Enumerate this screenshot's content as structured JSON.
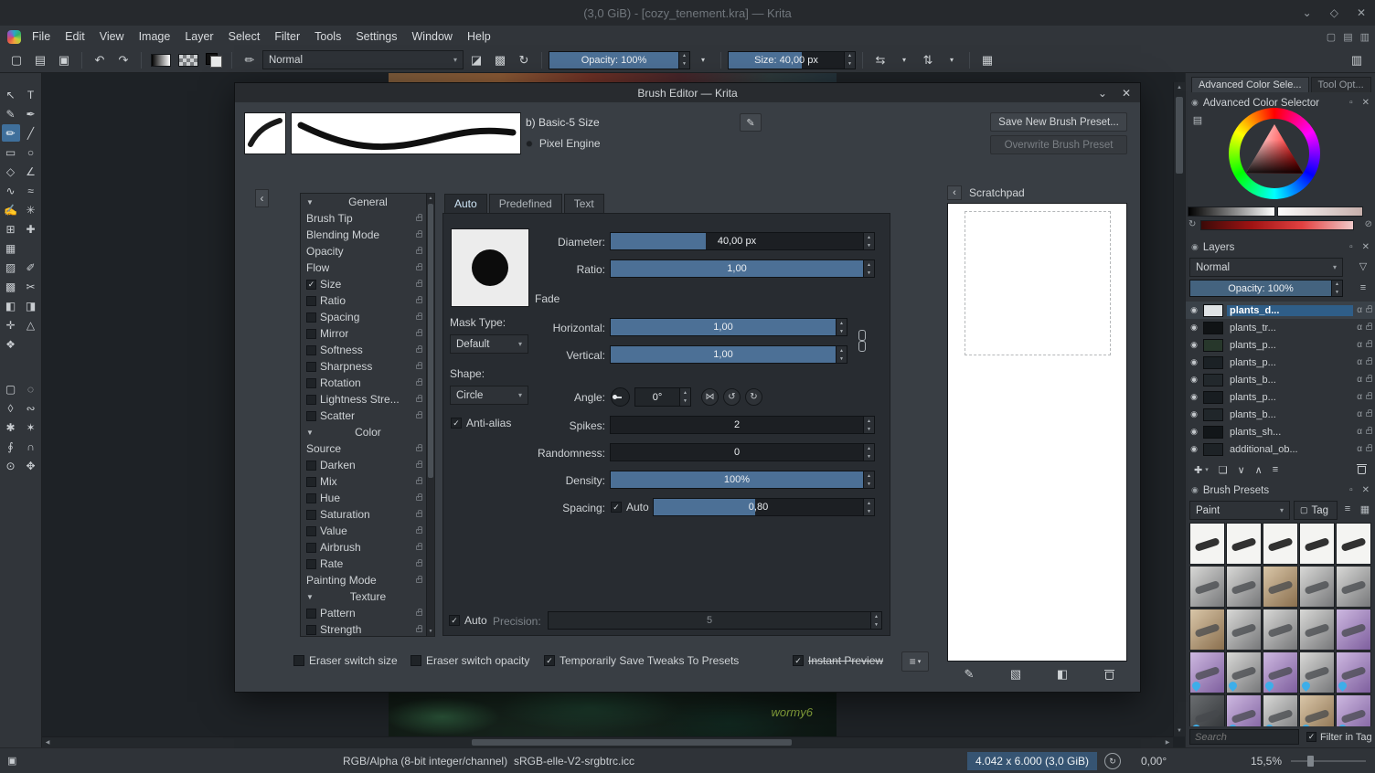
{
  "icons": {
    "chevron_down": "⌄",
    "diamond": "◇",
    "close": "✕",
    "new_document": "▢",
    "open_document": "▤",
    "save_document": "▣",
    "undo": "↶",
    "redo": "↷",
    "brush_settings": "✏",
    "eraser": "◪",
    "preserve_alpha": "▩",
    "reload": "↻",
    "dropdown": "▾",
    "mirror_horizontal": "⇆",
    "mirror_vertical": "⇅",
    "wrap_around": "▦",
    "workspace_chooser": "▥",
    "dockers_a": "▢",
    "dockers_b": "▤",
    "dockers_c": "▥",
    "collapse_left": "‹",
    "section_arrow": "▼",
    "edit_pencil": "✎",
    "engine_dot": "●",
    "scroll_up": "▲",
    "scroll_down": "▼",
    "scroll_left": "◀",
    "scroll_right": "▶",
    "angle_flip": "⋈",
    "rotate_ccw": "↺",
    "rotate_cw": "↻",
    "hamburger": "≡",
    "eye": "◉",
    "alpha": "α",
    "docker_dot": "◉",
    "float_panel": "▫",
    "settings_list": "▤",
    "refresh": "↻",
    "clear": "⊘",
    "funnel": "▽",
    "add": "✚",
    "duplicate": "❏",
    "arrow_down": "∨",
    "arrow_up": "∧",
    "tag": "▢",
    "grid_view": "▦",
    "scratch_paint": "✎",
    "scratch_gradient": "▧",
    "scratch_fill": "◧",
    "rotation_reset": "↻",
    "selection_badge": "▣"
  },
  "window": {
    "title": "(3,0 GiB) - [cozy_tenement.kra] — Krita"
  },
  "menubar": {
    "items": [
      "File",
      "Edit",
      "View",
      "Image",
      "Layer",
      "Select",
      "Filter",
      "Tools",
      "Settings",
      "Window",
      "Help"
    ]
  },
  "toolbar": {
    "blend_mode": "Normal",
    "opacity": {
      "label": "Opacity: 100%",
      "fill": 100
    },
    "size": {
      "label": "Size: 40,00 px",
      "fill": 58
    }
  },
  "tools": [
    {
      "n": "select-shapes-tool",
      "g": "↖"
    },
    {
      "n": "text-tool",
      "g": "T"
    },
    {
      "n": "edit-shapes-tool",
      "g": "✎"
    },
    {
      "n": "calligraphy-tool",
      "g": "✒"
    },
    {
      "n": "freehand-brush-tool",
      "g": "✏",
      "active": true
    },
    {
      "n": "line-tool",
      "g": "╱"
    },
    {
      "n": "rectangle-tool",
      "g": "▭"
    },
    {
      "n": "ellipse-tool",
      "g": "○"
    },
    {
      "n": "polygon-tool",
      "g": "◇"
    },
    {
      "n": "polyline-tool",
      "g": "∠"
    },
    {
      "n": "bezier-curve-tool",
      "g": "∿"
    },
    {
      "n": "freehand-path-tool",
      "g": "≈"
    },
    {
      "n": "dynamic-brush-tool",
      "g": "✍"
    },
    {
      "n": "multibrush-tool",
      "g": "✳"
    },
    {
      "n": "transform-tool",
      "g": "⊞"
    },
    {
      "n": "move-tool",
      "g": "✚"
    },
    {
      "n": "crop-tool",
      "g": "▦"
    },
    null,
    {
      "n": "gradient-tool",
      "g": "▨"
    },
    {
      "n": "color-sampler-tool",
      "g": "✐"
    },
    {
      "n": "pattern-edit-tool",
      "g": "▩"
    },
    {
      "n": "smart-patch-tool",
      "g": "✂"
    },
    {
      "n": "fill-tool",
      "g": "◧"
    },
    {
      "n": "enclose-fill-tool",
      "g": "◨"
    },
    {
      "n": "assistants-tool",
      "g": "✛"
    },
    {
      "n": "measure-tool",
      "g": "△"
    },
    {
      "n": "reference-images-tool",
      "g": "❖"
    },
    null,
    {
      "gap": true
    },
    {
      "gap": true
    },
    {
      "n": "rectangular-select-tool",
      "g": "▢"
    },
    {
      "n": "elliptical-select-tool",
      "g": "◌"
    },
    {
      "n": "polygonal-select-tool",
      "g": "◊"
    },
    {
      "n": "freehand-select-tool",
      "g": "∾"
    },
    {
      "n": "similar-color-select-tool",
      "g": "✱"
    },
    {
      "n": "contiguous-select-tool",
      "g": "✶"
    },
    {
      "n": "bezier-select-tool",
      "g": "∮"
    },
    {
      "n": "magnetic-select-tool",
      "g": "∩"
    },
    {
      "n": "zoom-tool",
      "g": "⊙"
    },
    {
      "n": "pan-tool",
      "g": "✥"
    }
  ],
  "canvas": {
    "signature": "wormy6"
  },
  "dialog": {
    "title": "Brush Editor — Krita",
    "preset_name": "b) Basic-5 Size",
    "engine": "Pixel Engine",
    "save_new_button": "Save New Brush Preset...",
    "overwrite_button": "Overwrite Brush Preset",
    "tabs": [
      {
        "label": "Auto",
        "active": true
      },
      {
        "label": "Predefined",
        "active": false
      },
      {
        "label": "Text",
        "active": false
      }
    ],
    "options": [
      {
        "t": "h",
        "label": "General"
      },
      {
        "t": "i",
        "label": "Brush Tip",
        "cb": null
      },
      {
        "t": "i",
        "label": "Blending Mode",
        "cb": null
      },
      {
        "t": "i",
        "label": "Opacity",
        "cb": null
      },
      {
        "t": "i",
        "label": "Flow",
        "cb": null
      },
      {
        "t": "i",
        "label": "Size",
        "cb": true
      },
      {
        "t": "i",
        "label": "Ratio",
        "cb": false
      },
      {
        "t": "i",
        "label": "Spacing",
        "cb": false
      },
      {
        "t": "i",
        "label": "Mirror",
        "cb": false
      },
      {
        "t": "i",
        "label": "Softness",
        "cb": false
      },
      {
        "t": "i",
        "label": "Sharpness",
        "cb": false
      },
      {
        "t": "i",
        "label": "Rotation",
        "cb": false
      },
      {
        "t": "i",
        "label": "Lightness Stre...",
        "cb": false
      },
      {
        "t": "i",
        "label": "Scatter",
        "cb": false
      },
      {
        "t": "h",
        "label": "Color"
      },
      {
        "t": "i",
        "label": "Source",
        "cb": null
      },
      {
        "t": "i",
        "label": "Darken",
        "cb": false
      },
      {
        "t": "i",
        "label": "Mix",
        "cb": false
      },
      {
        "t": "i",
        "label": "Hue",
        "cb": false
      },
      {
        "t": "i",
        "label": "Saturation",
        "cb": false
      },
      {
        "t": "i",
        "label": "Value",
        "cb": false
      },
      {
        "t": "i",
        "label": "Airbrush",
        "cb": false
      },
      {
        "t": "i",
        "label": "Rate",
        "cb": false
      },
      {
        "t": "i",
        "label": "Painting Mode",
        "cb": null
      },
      {
        "t": "h",
        "label": "Texture"
      },
      {
        "t": "i",
        "label": "Pattern",
        "cb": false
      },
      {
        "t": "i",
        "label": "Strength",
        "cb": false
      }
    ],
    "fields": {
      "diameter": {
        "label": "Diameter:",
        "value": "40,00 px",
        "fill": 36
      },
      "ratio": {
        "label": "Ratio:",
        "value": "1,00",
        "fill": 100
      },
      "fade": "Fade",
      "mask_type": {
        "label": "Mask Type:",
        "value": "Default"
      },
      "horizontal": {
        "label": "Horizontal:",
        "value": "1,00",
        "fill": 100
      },
      "vertical": {
        "label": "Vertical:",
        "value": "1,00",
        "fill": 100
      },
      "shape": {
        "label": "Shape:",
        "value": "Circle"
      },
      "angle": {
        "label": "Angle:",
        "value": "0°"
      },
      "antialias": {
        "label": "Anti-alias",
        "checked": true
      },
      "spikes": {
        "label": "Spikes:",
        "value": "2",
        "fill": 0
      },
      "randomness": {
        "label": "Randomness:",
        "value": "0",
        "fill": 0
      },
      "density": {
        "label": "Density:",
        "value": "100%",
        "fill": 100
      },
      "spacing": {
        "label": "Spacing:",
        "auto_label": "Auto",
        "auto_checked": true,
        "value": "0,80",
        "fill": 46
      },
      "precision": {
        "auto_label": "Auto",
        "auto_checked": true,
        "label": "Precision:",
        "value": "5",
        "fill": 0
      }
    },
    "footer": {
      "eraser_switch_size": {
        "label": "Eraser switch size",
        "checked": false
      },
      "eraser_switch_opacity": {
        "label": "Eraser switch opacity",
        "checked": false
      },
      "save_tweaks": {
        "label": "Temporarily Save Tweaks To Presets",
        "checked": true
      },
      "instant_preview": {
        "label": "Instant Preview",
        "checked": true
      }
    },
    "scratchpad": {
      "title": "Scratchpad"
    }
  },
  "dock": {
    "tabs": [
      {
        "label": "Advanced Color Sele...",
        "active": true
      },
      {
        "label": "Tool Opt...",
        "active": false
      }
    ],
    "color_selector": {
      "title": "Advanced Color Selector"
    },
    "layers": {
      "title": "Layers",
      "blend_mode": "Normal",
      "opacity": {
        "label": "Opacity: 100%",
        "fill": 100
      },
      "rows": [
        {
          "name": "plants_d...",
          "selected": true,
          "thumb": "#dfe3e6"
        },
        {
          "name": "plants_tr...",
          "thumb": "#101315"
        },
        {
          "name": "plants_p...",
          "thumb": "#27372b"
        },
        {
          "name": "plants_p...",
          "thumb": "#1b2125"
        },
        {
          "name": "plants_b...",
          "thumb": "#22282c"
        },
        {
          "name": "plants_p...",
          "thumb": "#181d21"
        },
        {
          "name": "plants_b...",
          "thumb": "#20262a"
        },
        {
          "name": "plants_sh...",
          "thumb": "#121619"
        },
        {
          "name": "additional_ob...",
          "thumb": "#1d2226"
        }
      ]
    },
    "brush_presets": {
      "title": "Brush Presets",
      "tag_filter": "Paint",
      "tag_button": "Tag",
      "search_placeholder": "Search",
      "filter_in_tag": {
        "label": "Filter in Tag",
        "checked": true
      },
      "cells": [
        {
          "kind": "ink"
        },
        {
          "kind": "ink"
        },
        {
          "kind": "ink"
        },
        {
          "kind": "ink"
        },
        {
          "kind": "ink"
        },
        {
          "kind": "gray"
        },
        {
          "kind": "gray"
        },
        {
          "kind": "tan"
        },
        {
          "kind": "gray"
        },
        {
          "kind": "gray"
        },
        {
          "kind": "tan"
        },
        {
          "kind": "gray"
        },
        {
          "kind": "gray"
        },
        {
          "kind": "gray"
        },
        {
          "kind": "purple"
        },
        {
          "kind": "purple",
          "badge": true
        },
        {
          "kind": "gray",
          "badge": true
        },
        {
          "kind": "purple",
          "badge": true
        },
        {
          "kind": "gray",
          "badge": true
        },
        {
          "kind": "purple",
          "badge": true
        },
        {
          "kind": "dark",
          "badge": true
        },
        {
          "kind": "purple",
          "badge": true
        },
        {
          "kind": "gray",
          "badge": true
        },
        {
          "kind": "tan",
          "badge": true
        },
        {
          "kind": "purple",
          "badge": true
        }
      ]
    }
  },
  "statusbar": {
    "color_mode": "RGB/Alpha (8-bit integer/channel)",
    "profile": "sRGB-elle-V2-srgbtrc.icc",
    "size_info": "4.042 x 6.000 (3,0 GiB)",
    "rotation": "0,00°",
    "zoom": "15,5%"
  }
}
